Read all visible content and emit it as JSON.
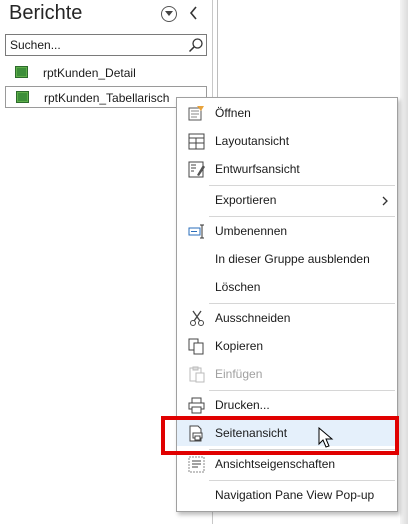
{
  "nav": {
    "title": "Berichte",
    "search": {
      "placeholder": "Suchen..."
    },
    "items": [
      {
        "label": "rptKunden_Detail",
        "selected": false
      },
      {
        "label": "rptKunden_Tabellarisch",
        "selected": true
      }
    ]
  },
  "context_menu": {
    "items": [
      {
        "label": "Öffnen",
        "icon": "open-report-icon",
        "enabled": true
      },
      {
        "label": "Layoutansicht",
        "icon": "layout-view-icon",
        "enabled": true
      },
      {
        "label": "Entwurfsansicht",
        "icon": "design-view-icon",
        "enabled": true
      },
      {
        "label": "Exportieren",
        "icon": "",
        "enabled": true,
        "submenu": true
      },
      {
        "label": "Umbenennen",
        "icon": "rename-icon",
        "enabled": true
      },
      {
        "label": "In dieser Gruppe ausblenden",
        "icon": "",
        "enabled": true
      },
      {
        "label": "Löschen",
        "icon": "",
        "enabled": true
      },
      {
        "label": "Ausschneiden",
        "icon": "scissors-icon",
        "enabled": true
      },
      {
        "label": "Kopieren",
        "icon": "copy-icon",
        "enabled": true
      },
      {
        "label": "Einfügen",
        "icon": "paste-icon",
        "enabled": false
      },
      {
        "label": "Drucken...",
        "icon": "printer-icon",
        "enabled": true
      },
      {
        "label": "Seitenansicht",
        "icon": "print-preview-icon",
        "enabled": true,
        "hovered": true
      },
      {
        "label": "Ansichtseigenschaften",
        "icon": "properties-icon",
        "enabled": true
      },
      {
        "label": "Navigation Pane View Pop-up",
        "icon": "",
        "enabled": true
      }
    ]
  },
  "colors": {
    "highlight": "#e00000",
    "report_icon": "#3a8a3a",
    "hover_bg": "#e5f0fb"
  }
}
